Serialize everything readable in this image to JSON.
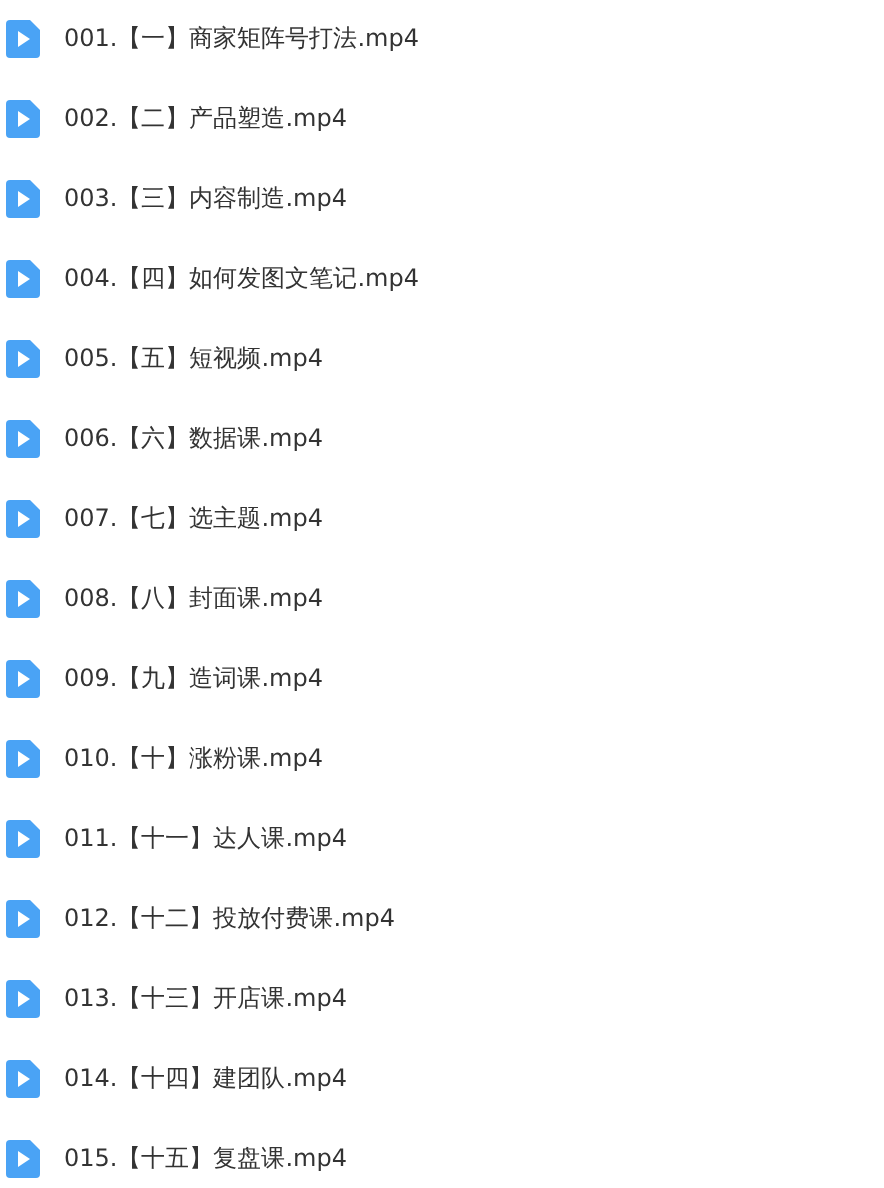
{
  "files": [
    {
      "name": "001.【一】商家矩阵号打法.mp4"
    },
    {
      "name": "002.【二】产品塑造.mp4"
    },
    {
      "name": "003.【三】内容制造.mp4"
    },
    {
      "name": "004.【四】如何发图文笔记.mp4"
    },
    {
      "name": "005.【五】短视频.mp4"
    },
    {
      "name": "006.【六】数据课.mp4"
    },
    {
      "name": "007.【七】选主题.mp4"
    },
    {
      "name": "008.【八】封面课.mp4"
    },
    {
      "name": "009.【九】造词课.mp4"
    },
    {
      "name": "010.【十】涨粉课.mp4"
    },
    {
      "name": "011.【十一】达人课.mp4"
    },
    {
      "name": "012.【十二】投放付费课.mp4"
    },
    {
      "name": "013.【十三】开店课.mp4"
    },
    {
      "name": "014.【十四】建团队.mp4"
    },
    {
      "name": "015.【十五】复盘课.mp4"
    }
  ]
}
